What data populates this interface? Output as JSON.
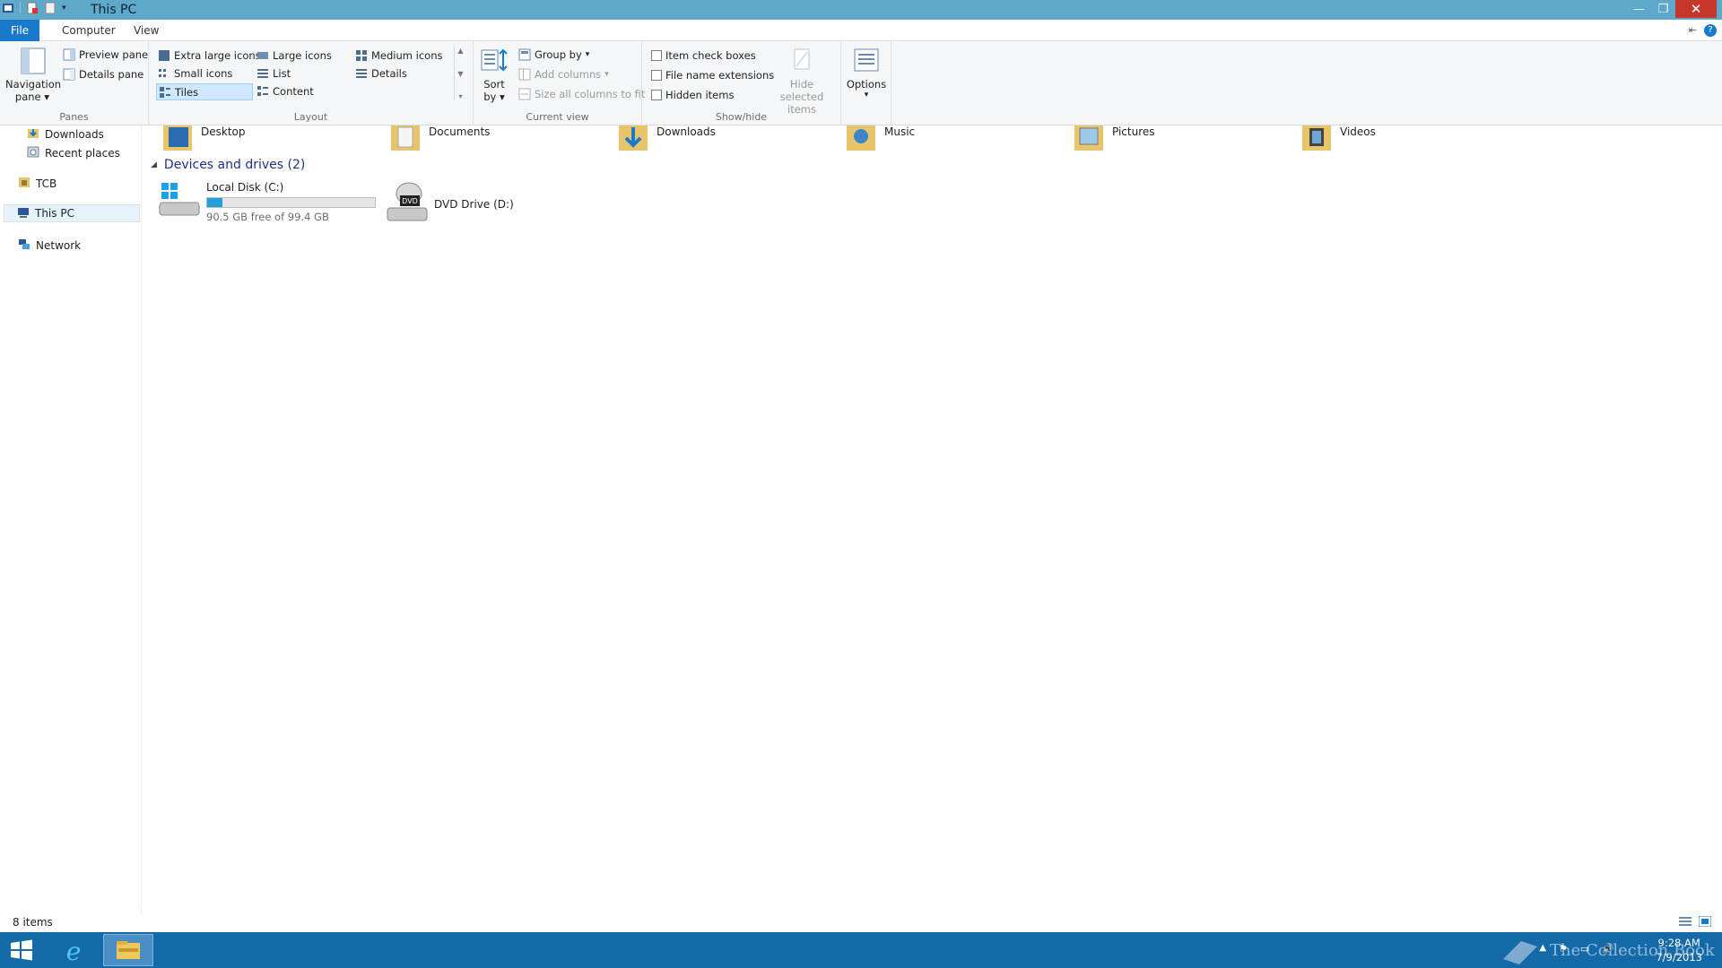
{
  "window": {
    "title": "This PC"
  },
  "tabs": {
    "file": "File",
    "computer": "Computer",
    "view": "View"
  },
  "ribbon": {
    "panes": {
      "navigation_pane": "Navigation",
      "navigation_pane_2": "pane",
      "preview_pane": "Preview pane",
      "details_pane": "Details pane",
      "label": "Panes"
    },
    "layout": {
      "extra_large_icons": "Extra large icons",
      "large_icons": "Large icons",
      "medium_icons": "Medium icons",
      "small_icons": "Small icons",
      "list": "List",
      "details": "Details",
      "tiles": "Tiles",
      "content": "Content",
      "label": "Layout",
      "selected": "Tiles"
    },
    "current_view": {
      "sort_by": "Sort",
      "sort_by_2": "by",
      "group_by": "Group by",
      "add_columns": "Add columns",
      "size_all_columns": "Size all columns to fit",
      "label": "Current view"
    },
    "show_hide": {
      "item_check_boxes": "Item check boxes",
      "file_name_extensions": "File name extensions",
      "hidden_items": "Hidden items",
      "hide_selected": "Hide selected",
      "hide_selected_2": "items",
      "label": "Show/hide"
    },
    "options": {
      "label": "Options"
    }
  },
  "nav": {
    "downloads": "Downloads",
    "recent_places": "Recent places",
    "tcb": "TCB",
    "this_pc": "This PC",
    "network": "Network"
  },
  "folders": [
    {
      "label": "Desktop"
    },
    {
      "label": "Documents"
    },
    {
      "label": "Downloads"
    },
    {
      "label": "Music"
    },
    {
      "label": "Pictures"
    },
    {
      "label": "Videos"
    }
  ],
  "devices": {
    "header": "Devices and drives (2)",
    "local_disk": {
      "name": "Local Disk (C:)",
      "free": "90.5 GB free of 99.4 GB",
      "used_fraction": 0.09
    },
    "dvd": {
      "name": "DVD Drive (D:)"
    }
  },
  "status": {
    "count": "8 items"
  },
  "taskbar": {
    "watermark": "The Collection Book",
    "time": "9:28 AM",
    "date": "7/9/2013"
  },
  "colors": {
    "titlebar": "#5ea8c9",
    "file_tab": "#1979ca",
    "taskbar": "#1469a8",
    "accent_bar": "#26a0da"
  }
}
